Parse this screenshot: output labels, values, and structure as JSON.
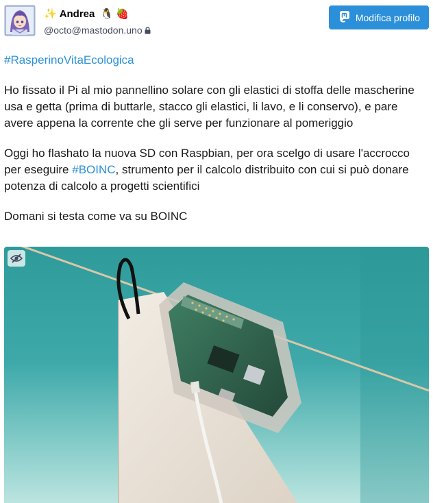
{
  "author": {
    "sparkle_emoji": "✨",
    "display_name": "Andrea",
    "penguin_emoji": "🐧",
    "raspberry_emoji": "🍓",
    "handle": "@octo@mastodon.uno",
    "locked_icon": "lock-icon",
    "avatar_icon": "anime-avatar-icon"
  },
  "actions": {
    "edit_profile_label": "Modifica profilo",
    "edit_profile_icon": "mastodon-icon"
  },
  "post": {
    "hashtag_title": "#RasperinoVitaEcologica",
    "paragraph1": "Ho fissato il Pi al mio pannellino solare con gli elastici di stoffa delle mascherine usa e getta (prima di buttarle, stacco gli elastici, li lavo, e li conservo), e pare avere appena la corrente che gli serve per funzionare al pomeriggio",
    "paragraph2_before": "Oggi ho flashato la nuova SD con Raspbian, per ora scelgo di usare l'accrocco per eseguire ",
    "paragraph2_hashtag": "#BOINC",
    "paragraph2_after": ", strumento per il calcolo distribuito con cui si può donare potenza di calcolo a progetti scientifici",
    "paragraph3": "Domani si testa come va su BOINC"
  },
  "media": {
    "hide_icon": "eye-slash-icon"
  },
  "colors": {
    "accent": "#2b90d9",
    "text": "#1a1a1a",
    "muted": "#444b5d"
  }
}
